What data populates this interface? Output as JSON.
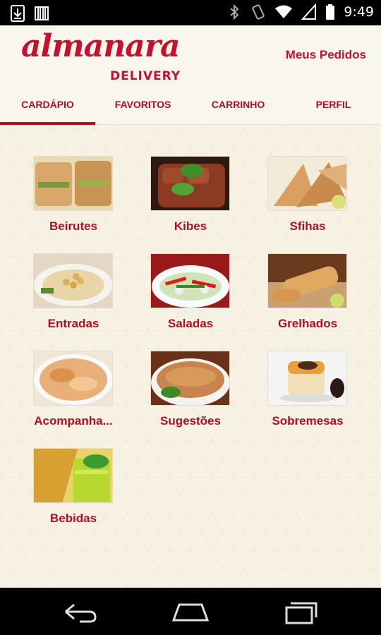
{
  "status_bar": {
    "time": "9:49"
  },
  "header": {
    "logo_script": "almanara",
    "logo_sub": "DELIVERY",
    "orders_link": "Meus Pedidos"
  },
  "tabs": [
    {
      "label": "CARDÁPIO",
      "active": true
    },
    {
      "label": "FAVORITOS",
      "active": false
    },
    {
      "label": "CARRINHO",
      "active": false
    },
    {
      "label": "PERFIL",
      "active": false
    }
  ],
  "categories": [
    {
      "label": "Beirutes"
    },
    {
      "label": "Kibes"
    },
    {
      "label": "Sfihas"
    },
    {
      "label": "Entradas"
    },
    {
      "label": "Saladas"
    },
    {
      "label": "Grelhados"
    },
    {
      "label": "Acompanha..."
    },
    {
      "label": "Sugestões"
    },
    {
      "label": "Sobremesas"
    },
    {
      "label": "Bebidas"
    }
  ],
  "colors": {
    "brand": "#c8102e",
    "tab_text": "#b01020",
    "background": "#f7f2e4"
  }
}
